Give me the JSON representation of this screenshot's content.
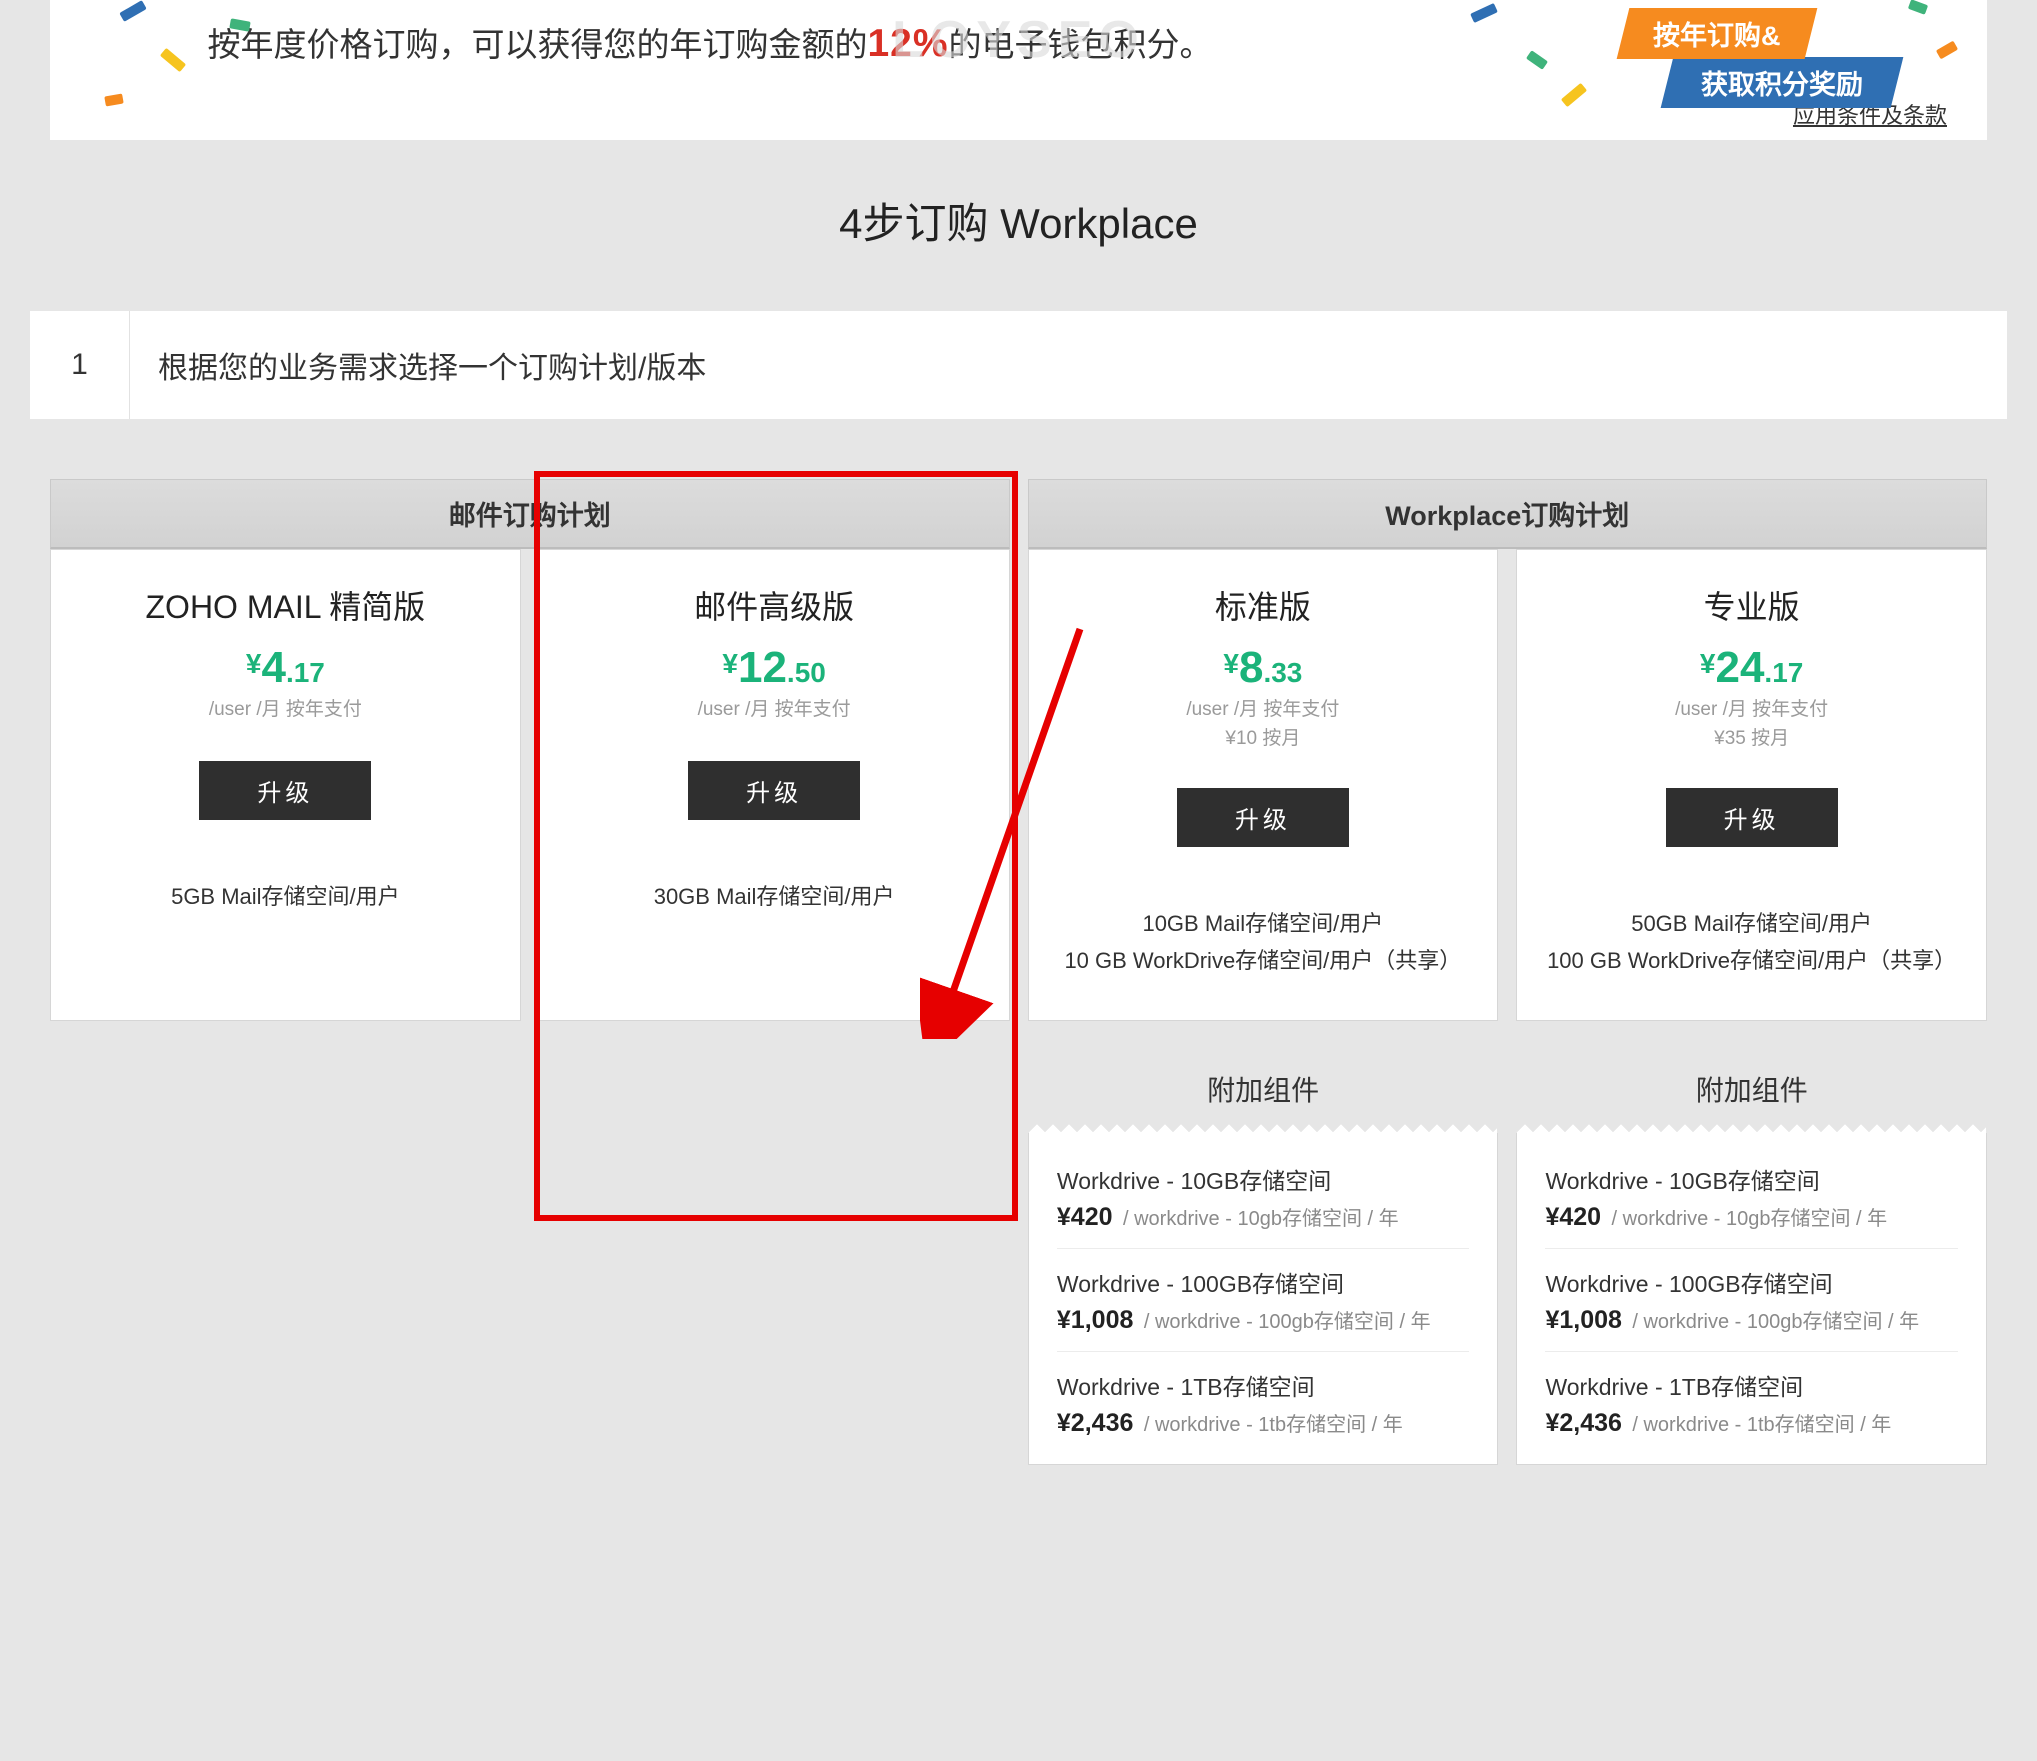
{
  "watermark": "LOYSEO",
  "promo": {
    "line": "按年度价格订购，可以获得您的年订购金额的",
    "percent": "12%",
    "line_tail": "的电子钱包积分。",
    "badge1": "按年订购&",
    "badge2": "获取积分奖励",
    "terms": "应用条件及条款"
  },
  "page_title": "4步订购 Workplace",
  "step": {
    "num": "1",
    "text": "根据您的业务需求选择一个订购计划/版本"
  },
  "categories": {
    "mail": "邮件订购计划",
    "workplace": "Workplace订购计划"
  },
  "plans": [
    {
      "name": "ZOHO MAIL 精简版",
      "cur": "¥",
      "maj": "4",
      "min": ".17",
      "sub": "/user /月 按年支付",
      "sub2": "",
      "btn": "升级",
      "features": [
        "5GB Mail存储空间/用户"
      ]
    },
    {
      "name": "邮件高级版",
      "cur": "¥",
      "maj": "12",
      "min": ".50",
      "sub": "/user /月 按年支付",
      "sub2": "",
      "btn": "升级",
      "features": [
        "30GB Mail存储空间/用户"
      ]
    },
    {
      "name": "标准版",
      "cur": "¥",
      "maj": "8",
      "min": ".33",
      "sub": "/user /月 按年支付",
      "sub2": "¥10 按月",
      "btn": "升级",
      "features": [
        "10GB Mail存储空间/用户",
        "10 GB WorkDrive存储空间/用户（共享）"
      ]
    },
    {
      "name": "专业版",
      "cur": "¥",
      "maj": "24",
      "min": ".17",
      "sub": "/user /月 按年支付",
      "sub2": "¥35 按月",
      "btn": "升级",
      "features": [
        "50GB Mail存储空间/用户",
        "100 GB WorkDrive存储空间/用户（共享）"
      ]
    }
  ],
  "addons": {
    "title": "附加组件",
    "items": [
      {
        "name": "Workdrive - 10GB存储空间",
        "price": "¥420",
        "desc": "/ workdrive - 10gb存储空间 / 年"
      },
      {
        "name": "Workdrive - 100GB存储空间",
        "price": "¥1,008",
        "desc": "/ workdrive - 100gb存储空间 / 年"
      },
      {
        "name": "Workdrive - 1TB存储空间",
        "price": "¥2,436",
        "desc": "/ workdrive - 1tb存储空间 / 年"
      }
    ]
  }
}
